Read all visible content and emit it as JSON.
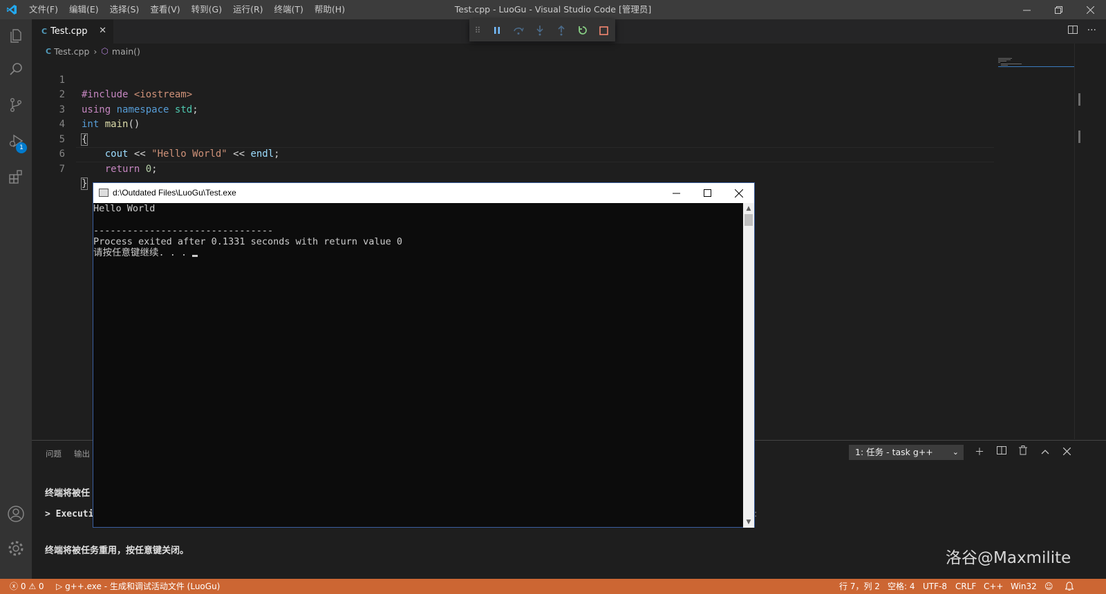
{
  "titlebar": {
    "menu": [
      "文件(F)",
      "编辑(E)",
      "选择(S)",
      "查看(V)",
      "转到(G)",
      "运行(R)",
      "终端(T)",
      "帮助(H)"
    ],
    "title": "Test.cpp - LuoGu - Visual Studio Code [管理员]"
  },
  "activitybar": {
    "items": [
      "explorer-icon",
      "search-icon",
      "source-control-icon",
      "run-debug-icon",
      "extensions-icon"
    ],
    "debug_badge": "1",
    "bottom": [
      "account-icon",
      "settings-gear-icon"
    ]
  },
  "tab": {
    "icon": "C",
    "label": "Test.cpp"
  },
  "breadcrumb": {
    "file": "Test.cpp",
    "symbol": "main()"
  },
  "code": {
    "line_numbers": [
      "1",
      "2",
      "3",
      "4",
      "5",
      "6",
      "7"
    ],
    "l1": {
      "a": "#include",
      "b": " <iostream>"
    },
    "l2": {
      "a": "using",
      "b": " ",
      "c": "namespace",
      "d": " ",
      "e": "std",
      "f": ";"
    },
    "l3": {
      "a": "int",
      "b": " ",
      "c": "main",
      "d": "()"
    },
    "l4": {
      "a": "{"
    },
    "l5": {
      "a": "    ",
      "b": "cout",
      "c": " << ",
      "d": "\"Hello World\"",
      "e": " << ",
      "f": "endl",
      "g": ";"
    },
    "l6": {
      "a": "    ",
      "b": "return",
      "c": " ",
      "d": "0",
      "e": ";"
    },
    "l7": {
      "a": "}"
    }
  },
  "panel": {
    "tabs": [
      "问题",
      "输出"
    ],
    "task_select": "1: 任务 - task g++",
    "line1": "终端将被任",
    "line2": "> Executin",
    "line3": "终端将被任务重用，按任意键关闭。",
    "right_fragment": ":"
  },
  "console": {
    "title": "d:\\Outdated Files\\LuoGu\\Test.exe",
    "lines": [
      "Hello World",
      "",
      "--------------------------------",
      "Process exited after 0.1331 seconds with return value 0",
      "请按任意键继续. . . "
    ]
  },
  "statusbar": {
    "errors": "0",
    "warnings": "0",
    "task": "g++.exe - 生成和调试活动文件 (LuoGu)",
    "position": "行 7，列 2",
    "spaces": "空格: 4",
    "encoding": "UTF-8",
    "eol": "CRLF",
    "language": "C++",
    "platform": "Win32"
  },
  "watermark": "洛谷@Maxmilite",
  "colors": {
    "statusbar": "#cc6633",
    "activitybar": "#333333",
    "editor": "#1e1e1e",
    "accent": "#007acc"
  }
}
